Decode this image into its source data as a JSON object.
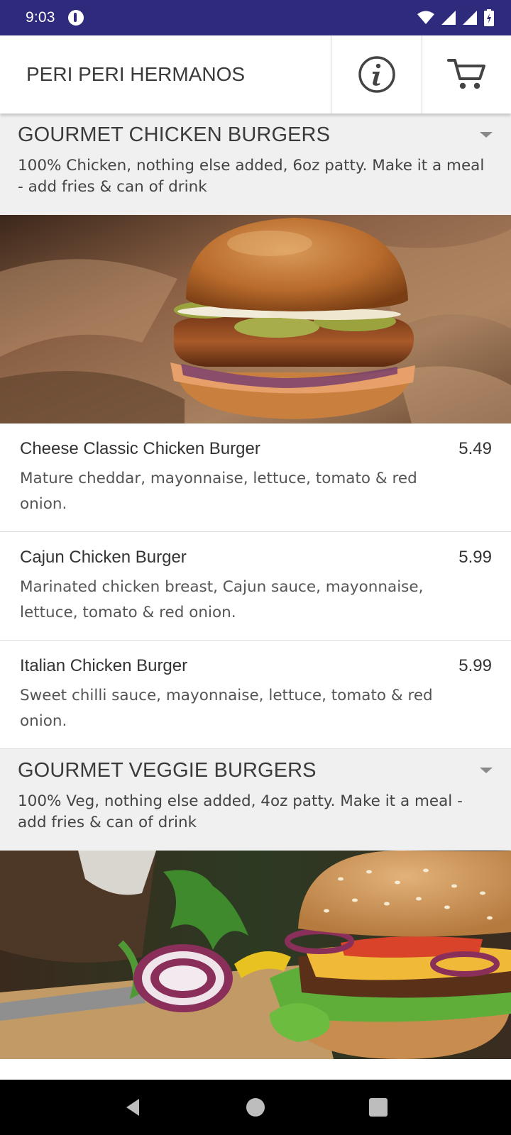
{
  "status": {
    "time": "9:03"
  },
  "app_bar": {
    "title": "PERI PERI HERMANOS",
    "info_icon": "info-icon",
    "cart_icon": "cart-icon"
  },
  "categories": [
    {
      "title": "GOURMET CHICKEN BURGERS",
      "description": "100% Chicken, nothing else added, 6oz patty. Make it a meal - add fries & can of drink",
      "items": [
        {
          "name": "Cheese Classic Chicken Burger",
          "price": "5.49",
          "description": "Mature cheddar, mayonnaise, lettuce, tomato & red onion."
        },
        {
          "name": "Cajun Chicken Burger",
          "price": "5.99",
          "description": "Marinated chicken breast, Cajun sauce, mayonnaise, lettuce, tomato & red onion."
        },
        {
          "name": "Italian Chicken Burger",
          "price": "5.99",
          "description": "Sweet chilli sauce, mayonnaise, lettuce, tomato & red onion."
        }
      ]
    },
    {
      "title": "GOURMET VEGGIE BURGERS",
      "description": "100% Veg, nothing else added, 4oz patty. Make it a meal - add fries & can of drink"
    }
  ],
  "colors": {
    "status_bar": "#2e2a7c",
    "category_bg": "#f0f0f0",
    "nav_bar": "#000000"
  }
}
